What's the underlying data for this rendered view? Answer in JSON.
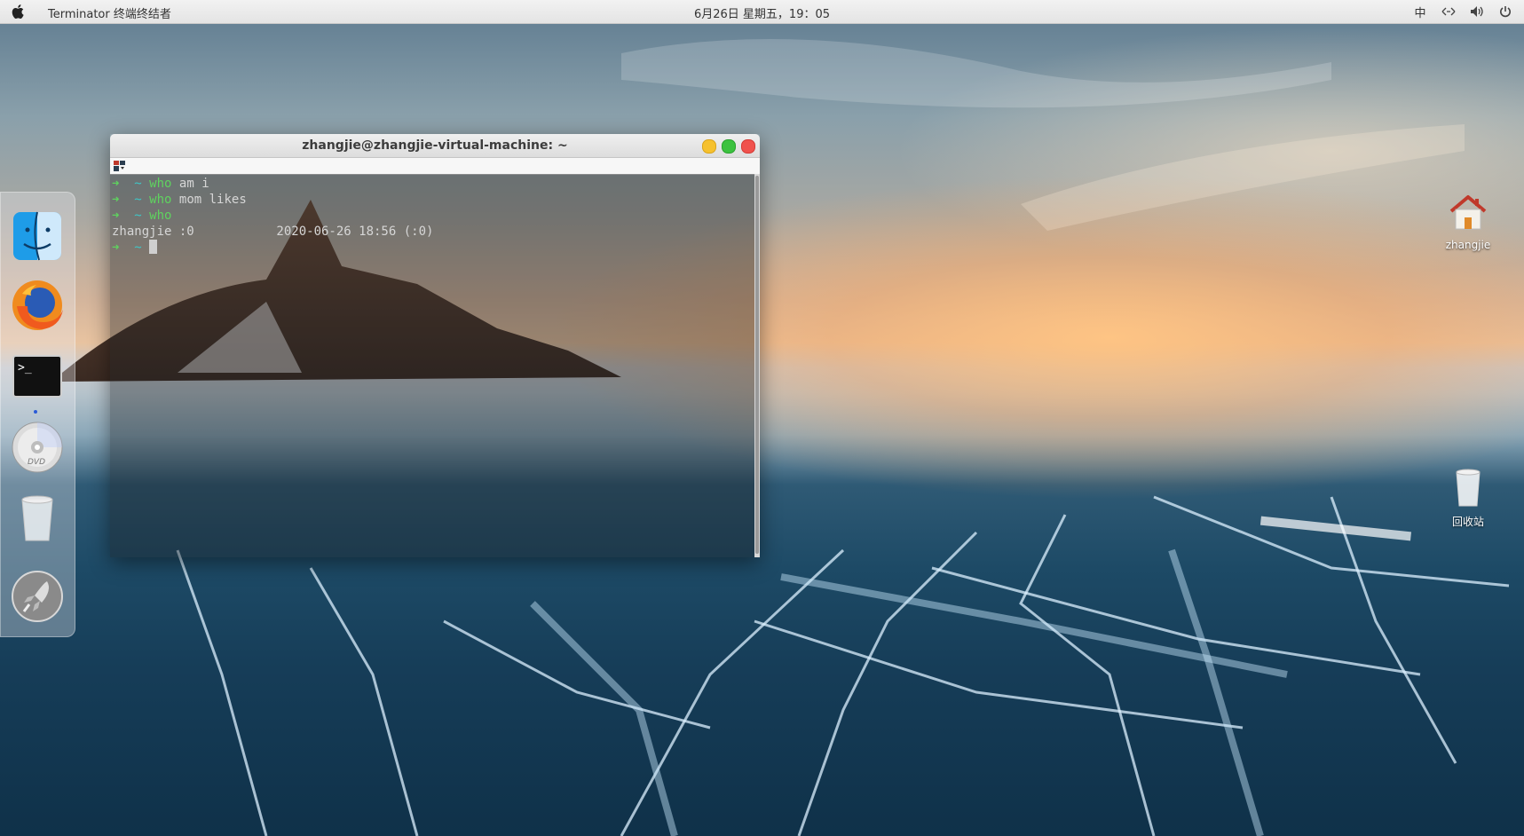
{
  "topbar": {
    "app_title": "Terminator 终端终结者",
    "clock": "6月26日 星期五，19：05",
    "tray": {
      "input_method": "中",
      "network_icon": "network-icon",
      "volume_icon": "volume-icon",
      "power_icon": "power-icon"
    }
  },
  "dock": {
    "items": [
      {
        "name": "finder",
        "icon": "finder-icon"
      },
      {
        "name": "firefox",
        "icon": "firefox-icon"
      },
      {
        "name": "terminal",
        "icon": "terminal-icon",
        "label": ">_"
      },
      {
        "name": "dvd",
        "icon": "dvd-icon",
        "label": "DVD"
      },
      {
        "name": "trash",
        "icon": "trash-icon"
      },
      {
        "name": "launchpad",
        "icon": "rocket-icon"
      }
    ]
  },
  "terminal": {
    "title": "zhangjie@zhangjie-virtual-machine: ~",
    "lines": [
      {
        "prompt": "➜",
        "dir": "~",
        "cmd": "who",
        "args": "am i"
      },
      {
        "prompt": "➜",
        "dir": "~",
        "cmd": "who",
        "args": "mom likes"
      },
      {
        "prompt": "➜",
        "dir": "~",
        "cmd": "who",
        "args": ""
      }
    ],
    "output": "zhangjie :0           2020-06-26 18:56 (:0)",
    "current_prompt": {
      "prompt": "➜",
      "dir": "~"
    }
  },
  "desktop": {
    "home_label": "zhangjie",
    "trash_label": "回收站"
  },
  "colors": {
    "prompt_green": "#5fd35f",
    "dir_cyan": "#3ec7c7"
  }
}
